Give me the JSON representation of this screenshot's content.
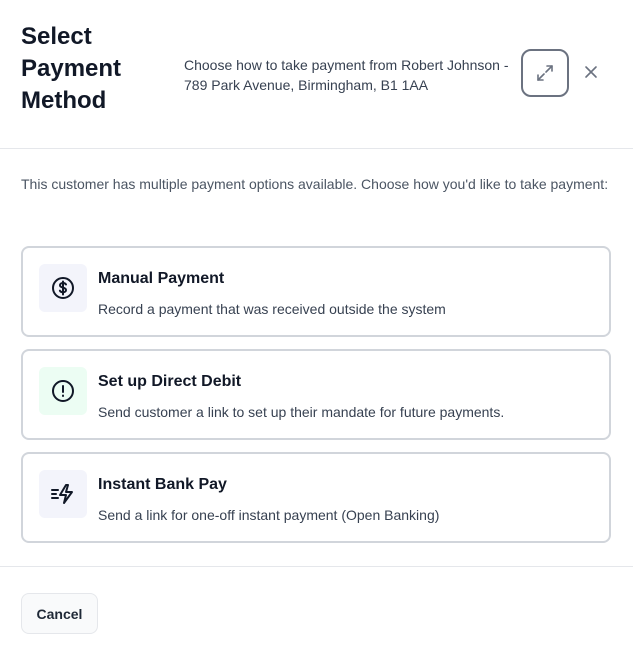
{
  "dialog": {
    "title": "Select Payment Method",
    "subtitle": "Choose how to take payment from Robert Johnson - 789 Park Avenue, Birmingham, B1 1AA",
    "expand_icon": "expand-icon",
    "close_icon": "close-icon"
  },
  "intro": "This customer has multiple payment options available. Choose how you'd like to take payment:",
  "options": [
    {
      "title": "Manual Payment",
      "description": "Record a payment that was received outside the system",
      "icon": "dollar-circle-icon",
      "icon_bg": "#f3f4fb"
    },
    {
      "title": "Set up Direct Debit",
      "description": "Send customer a link to set up their mandate for future payments.",
      "icon": "alert-circle-icon",
      "icon_bg": "#ecfdf3"
    },
    {
      "title": "Instant Bank Pay",
      "description": "Send a link for one-off instant payment (Open Banking)",
      "icon": "fast-lightning-icon",
      "icon_bg": "#f3f4fb"
    }
  ],
  "footer": {
    "cancel_label": "Cancel"
  }
}
